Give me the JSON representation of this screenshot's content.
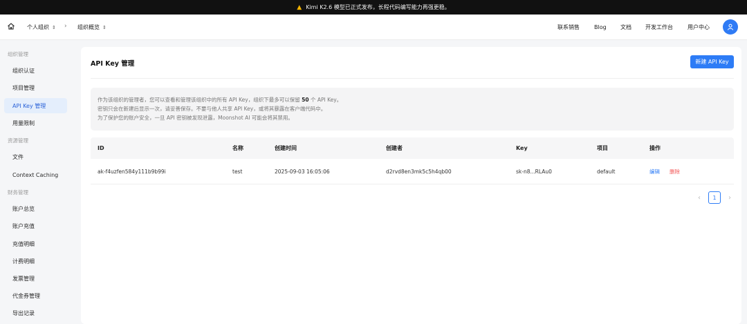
{
  "banner": {
    "text": "Kimi K2.6 模型已正式发布，长程代码编写能力再强更稳。"
  },
  "breadcrumb": {
    "org": "个人组织",
    "page": "组织概览"
  },
  "topnav": [
    "联系销售",
    "Blog",
    "文档",
    "开发工作台",
    "用户中心"
  ],
  "sidebar": {
    "groups": [
      "组织管理",
      "资源管理",
      "财务管理"
    ],
    "items": [
      "组织认证",
      "项目管理",
      "API Key 管理",
      "用量限制",
      "文件",
      "Context Caching",
      "账户总览",
      "账户充值",
      "充值明细",
      "计费明细",
      "发票管理",
      "代金券管理",
      "导出记录"
    ]
  },
  "main": {
    "title": "API Key 管理",
    "new_button": "新建 API Key",
    "notice": {
      "line1_pre": "作为该组织的管理者，您可以查看和管理该组织中的所有 API Key，组织下最多可以保留 ",
      "line1_num": "50",
      "line1_post": " 个 API Key。",
      "line2": "密钥只会在新建后显示一次，请妥善保存。不要与他人共享 API Key，或将其暴露在客户端代码中。",
      "line3": "为了保护您的账户安全，一旦 API 密钥被发现泄露，Moonshot AI 可能会将其禁用。"
    },
    "table": {
      "headers": [
        "ID",
        "名称",
        "创建时间",
        "创建者",
        "Key",
        "项目",
        "操作"
      ],
      "rows": [
        {
          "id": "ak-f4uzfen584y111b9b99i",
          "name": "test",
          "created": "2025-09-03 16:05:06",
          "creator": "d2rvd8en3mk5c5h4qb00",
          "key": "sk-n8...RLAu0",
          "project": "default",
          "edit": "编辑",
          "delete": "删除"
        }
      ]
    },
    "pagination": {
      "current": "1"
    }
  },
  "colors": {
    "accent": "#2d7cf6",
    "danger": "#f25757",
    "banner_bg": "#111111"
  }
}
